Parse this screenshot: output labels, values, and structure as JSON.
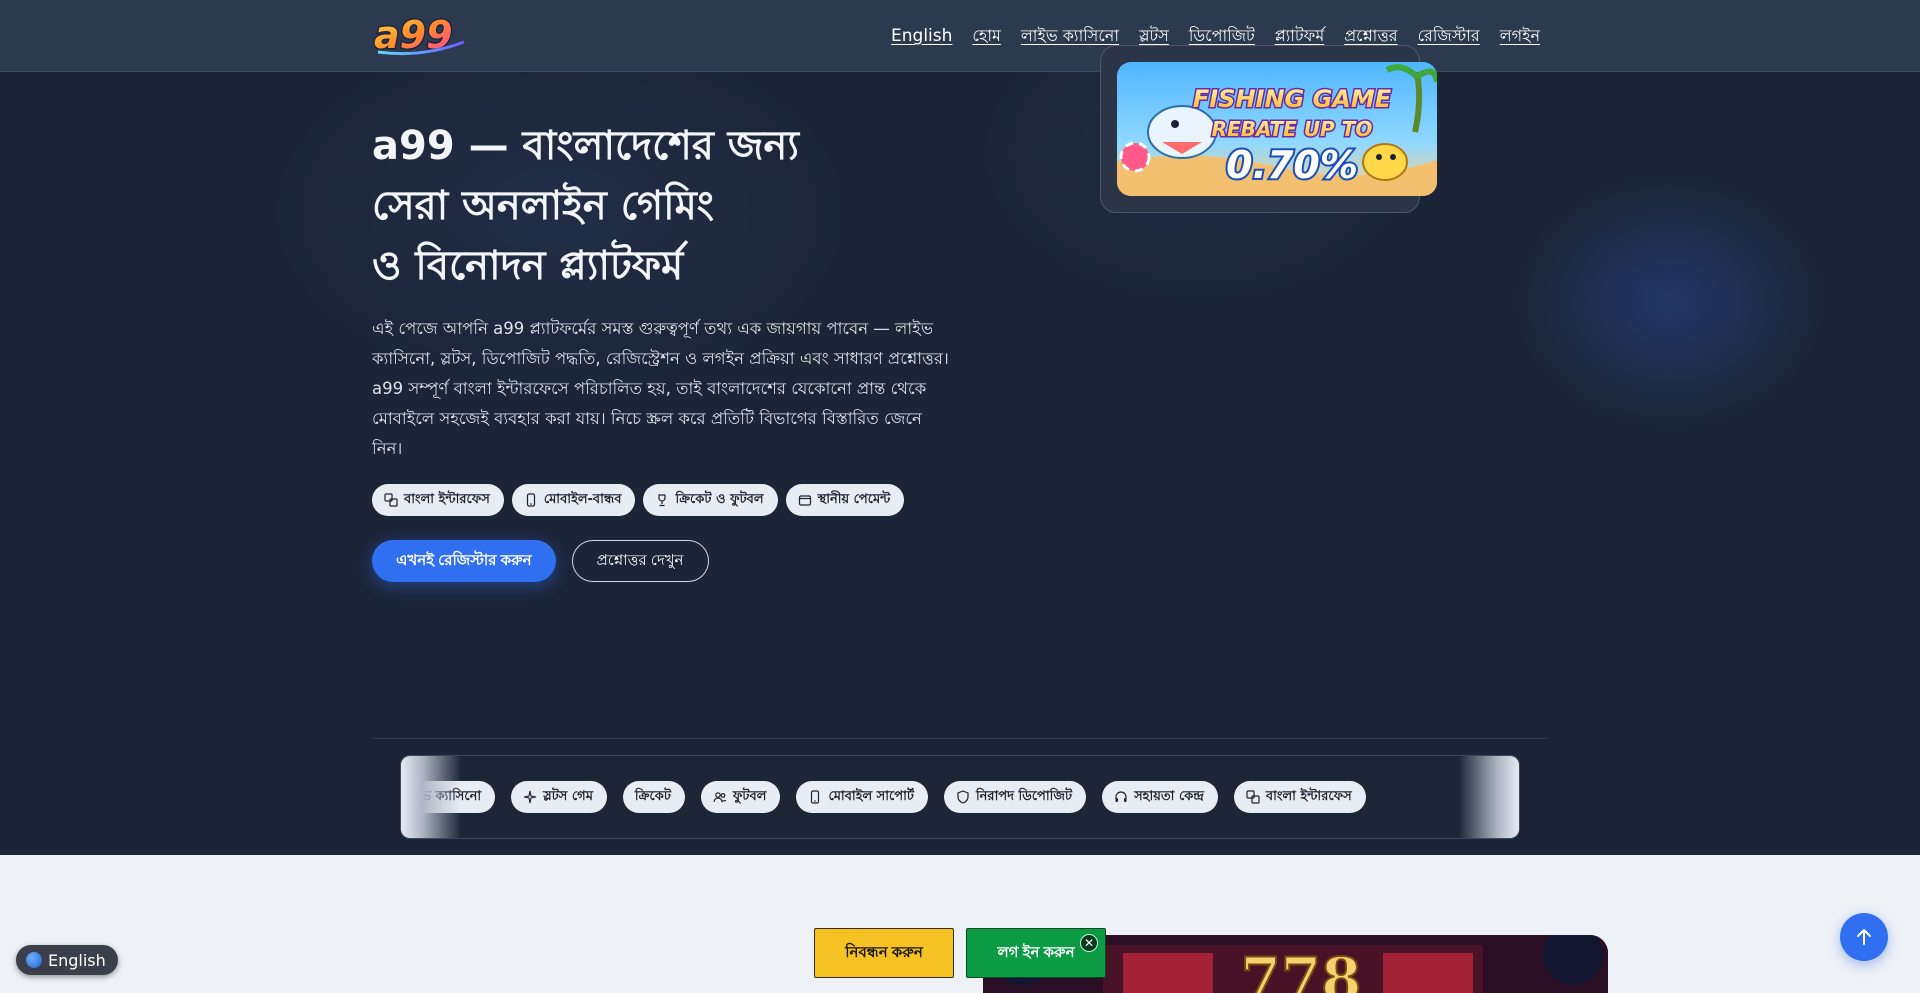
{
  "header": {
    "logo_text": "a99",
    "nav": [
      {
        "label": "English",
        "name": "nav-english"
      },
      {
        "label": "হোম",
        "name": "nav-home"
      },
      {
        "label": "লাইভ ক্যাসিনো",
        "name": "nav-live-casino"
      },
      {
        "label": "স্লটস",
        "name": "nav-slots"
      },
      {
        "label": "ডিপোজিট",
        "name": "nav-deposit"
      },
      {
        "label": "প্ল্যাটফর্ম",
        "name": "nav-platform"
      },
      {
        "label": "প্রশ্নোত্তর",
        "name": "nav-faq"
      },
      {
        "label": "রেজিস্টার",
        "name": "nav-register"
      },
      {
        "label": "লগইন",
        "name": "nav-login"
      }
    ]
  },
  "hero": {
    "title_line1": "a99 — বাংলাদেশের জন্য",
    "title_line2": "সেরা অনলাইন গেমিং",
    "title_line3": "ও বিনোদন প্ল্যাটফর্ম",
    "description": "এই পেজে আপনি a99 প্ল্যাটফর্মের সমস্ত গুরুত্বপূর্ণ তথ্য এক জায়গায় পাবেন — লাইভ ক্যাসিনো, স্লটস, ডিপোজিট পদ্ধতি, রেজিস্ট্রেশন ও লগইন প্রক্রিয়া এবং সাধারণ প্রশ্নোত্তর। a99 সম্পূর্ণ বাংলা ইন্টারফেসে পরিচালিত হয়, তাই বাংলাদেশের যেকোনো প্রান্ত থেকে মোবাইলে সহজেই ব্যবহার করা যায়। নিচে স্ক্রল করে প্রতিটি বিভাগের বিস্তারিত জেনে নিন।",
    "chips": [
      {
        "label": "বাংলা ইন্টারফেস",
        "icon": "translate-icon"
      },
      {
        "label": "মোবাইল-বান্ধব",
        "icon": "phone-icon"
      },
      {
        "label": "ক্রিকেট ও ফুটবল",
        "icon": "trophy-icon"
      },
      {
        "label": "স্থানীয় পেমেন্ট",
        "icon": "wallet-icon"
      }
    ],
    "primary_button": "এখনই রেজিস্টার করুন",
    "secondary_button": "প্রশ্নোত্তর দেখুন",
    "promo": {
      "line1": "FISHING GAME",
      "line2": "REBATE UP TO",
      "line3": "0.70%"
    }
  },
  "marquee": {
    "items": [
      {
        "label": "লাইভ ক্যাসিনো",
        "icon": ""
      },
      {
        "label": "স্লটস গেম",
        "icon": "sparkle-icon"
      },
      {
        "label": "ক্রিকেট",
        "icon": ""
      },
      {
        "label": "ফুটবল",
        "icon": "users-icon"
      },
      {
        "label": "মোবাইল সাপোর্ট",
        "icon": "phone-icon"
      },
      {
        "label": "নিরাপদ ডিপোজিট",
        "icon": "shield-icon"
      },
      {
        "label": "সহায়তা কেন্দ্র",
        "icon": "headset-icon"
      },
      {
        "label": "বাংলা ইন্টারফেস",
        "icon": "translate-icon"
      }
    ]
  },
  "floating": {
    "register_label": "নিবন্ধন করুন",
    "login_label": "লগ ইন করুন",
    "close_symbol": "✕",
    "language_label": "English",
    "game_banner_text": "778"
  },
  "colors": {
    "accent": "#2f6ff0",
    "header_bg": "#2c3a4f",
    "hero_bg": "#1c2538",
    "register_bg": "#f5c224",
    "login_bg": "#0c9a44"
  }
}
